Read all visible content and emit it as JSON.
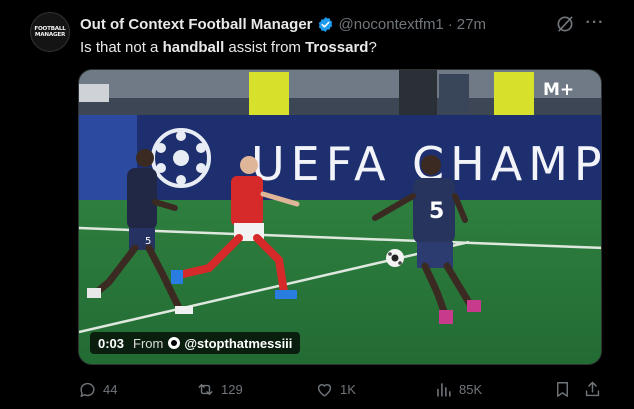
{
  "account": {
    "name": "Out of Context Football Manager",
    "handle": "@nocontextfm1",
    "separator": "·",
    "time": "27m",
    "avatar_line1": "FOOTBALL",
    "avatar_line2": "MANAGER"
  },
  "post": {
    "text_1": "Is that not a ",
    "text_bold_1": "handball",
    "text_2": " assist from ",
    "text_bold_2": "Trossard",
    "text_3": "?"
  },
  "video": {
    "time": "0:03",
    "from_label": "From",
    "source": "@stopthatmessiii",
    "broadcaster": "M+",
    "board_text": "UEFA CHAMP",
    "player_number": "5",
    "player_number_2": "5"
  },
  "actions": {
    "replies": "44",
    "reposts": "129",
    "likes": "1K",
    "views": "85K"
  },
  "colors": {
    "verified": "#1d9bf0",
    "muted": "#71767b",
    "pitch": "#2a7a3c",
    "board": "#1d2f6e"
  },
  "icons": [
    "verified-badge-icon",
    "grok-icon",
    "more-icon",
    "reply-icon",
    "repost-icon",
    "like-icon",
    "views-icon",
    "bookmark-icon",
    "share-icon"
  ]
}
